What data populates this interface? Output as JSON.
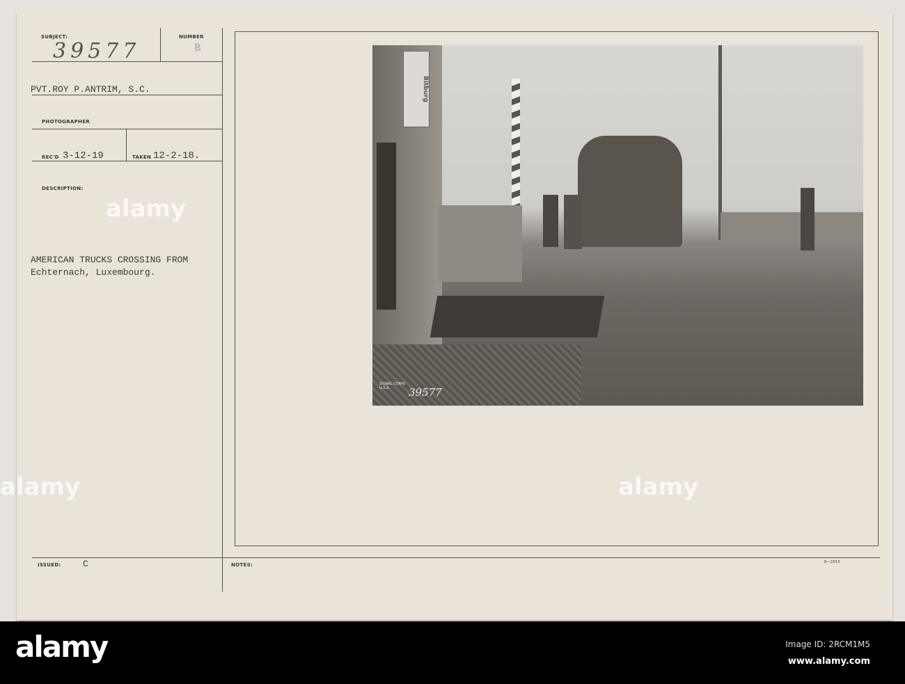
{
  "form": {
    "subject_label": "SUBJECT:",
    "subject_value": "39577",
    "number_label": "NUMBER",
    "number_value": "B",
    "photographer_name": "PVT.ROY P.ANTRIM, S.C.",
    "photographer_label": "PHOTOGRAPHER",
    "recd_label": "REC'D",
    "recd_value": "3-12-19",
    "taken_label": "TAKEN",
    "taken_value": "12-2-18.",
    "description_label": "DESCRIPTION:",
    "description_line1": "AMERICAN TRUCKS CROSSING FROM",
    "description_line2": "Echternach, Luxembourg.",
    "issued_label": "ISSUED:",
    "issued_value": "C",
    "notes_label": "NOTES:",
    "form_code": "8—3553"
  },
  "photo": {
    "sign_text": "Bitburg",
    "stamp_number": "39577",
    "stamp_text": "SIGNAL CORPS U.S.A."
  },
  "footer": {
    "brand": "alamy",
    "image_id": "Image ID: 2RCM1M5",
    "url": "www.alamy.com"
  }
}
